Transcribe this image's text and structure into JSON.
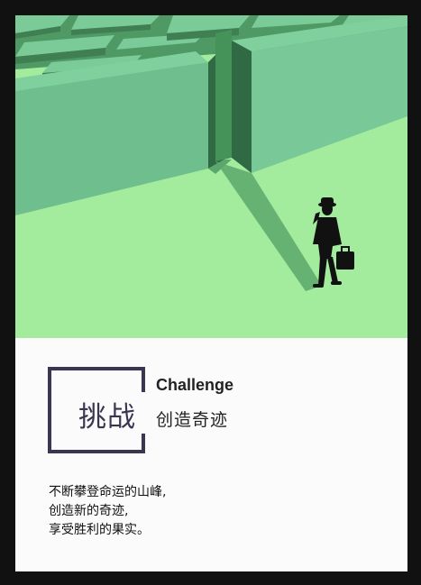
{
  "poster": {
    "title": "挑战",
    "subtitle_en": "Challenge",
    "subtitle_cn": "创造奇迹",
    "body_lines": [
      "不断攀登命运的山峰,",
      "创造新的奇迹,",
      "享受胜利的果实。"
    ]
  },
  "colors": {
    "frame": "#111111",
    "sky_green": "#a2ea9c",
    "wall_top": "#78c898",
    "wall_dark": "#3f7f52",
    "shadow": "#5faa6b",
    "title_dark": "#3a3550",
    "paper": "#fbfbfb"
  },
  "icons": [
    "maze-illustration",
    "businessman-silhouette",
    "briefcase-icon"
  ]
}
